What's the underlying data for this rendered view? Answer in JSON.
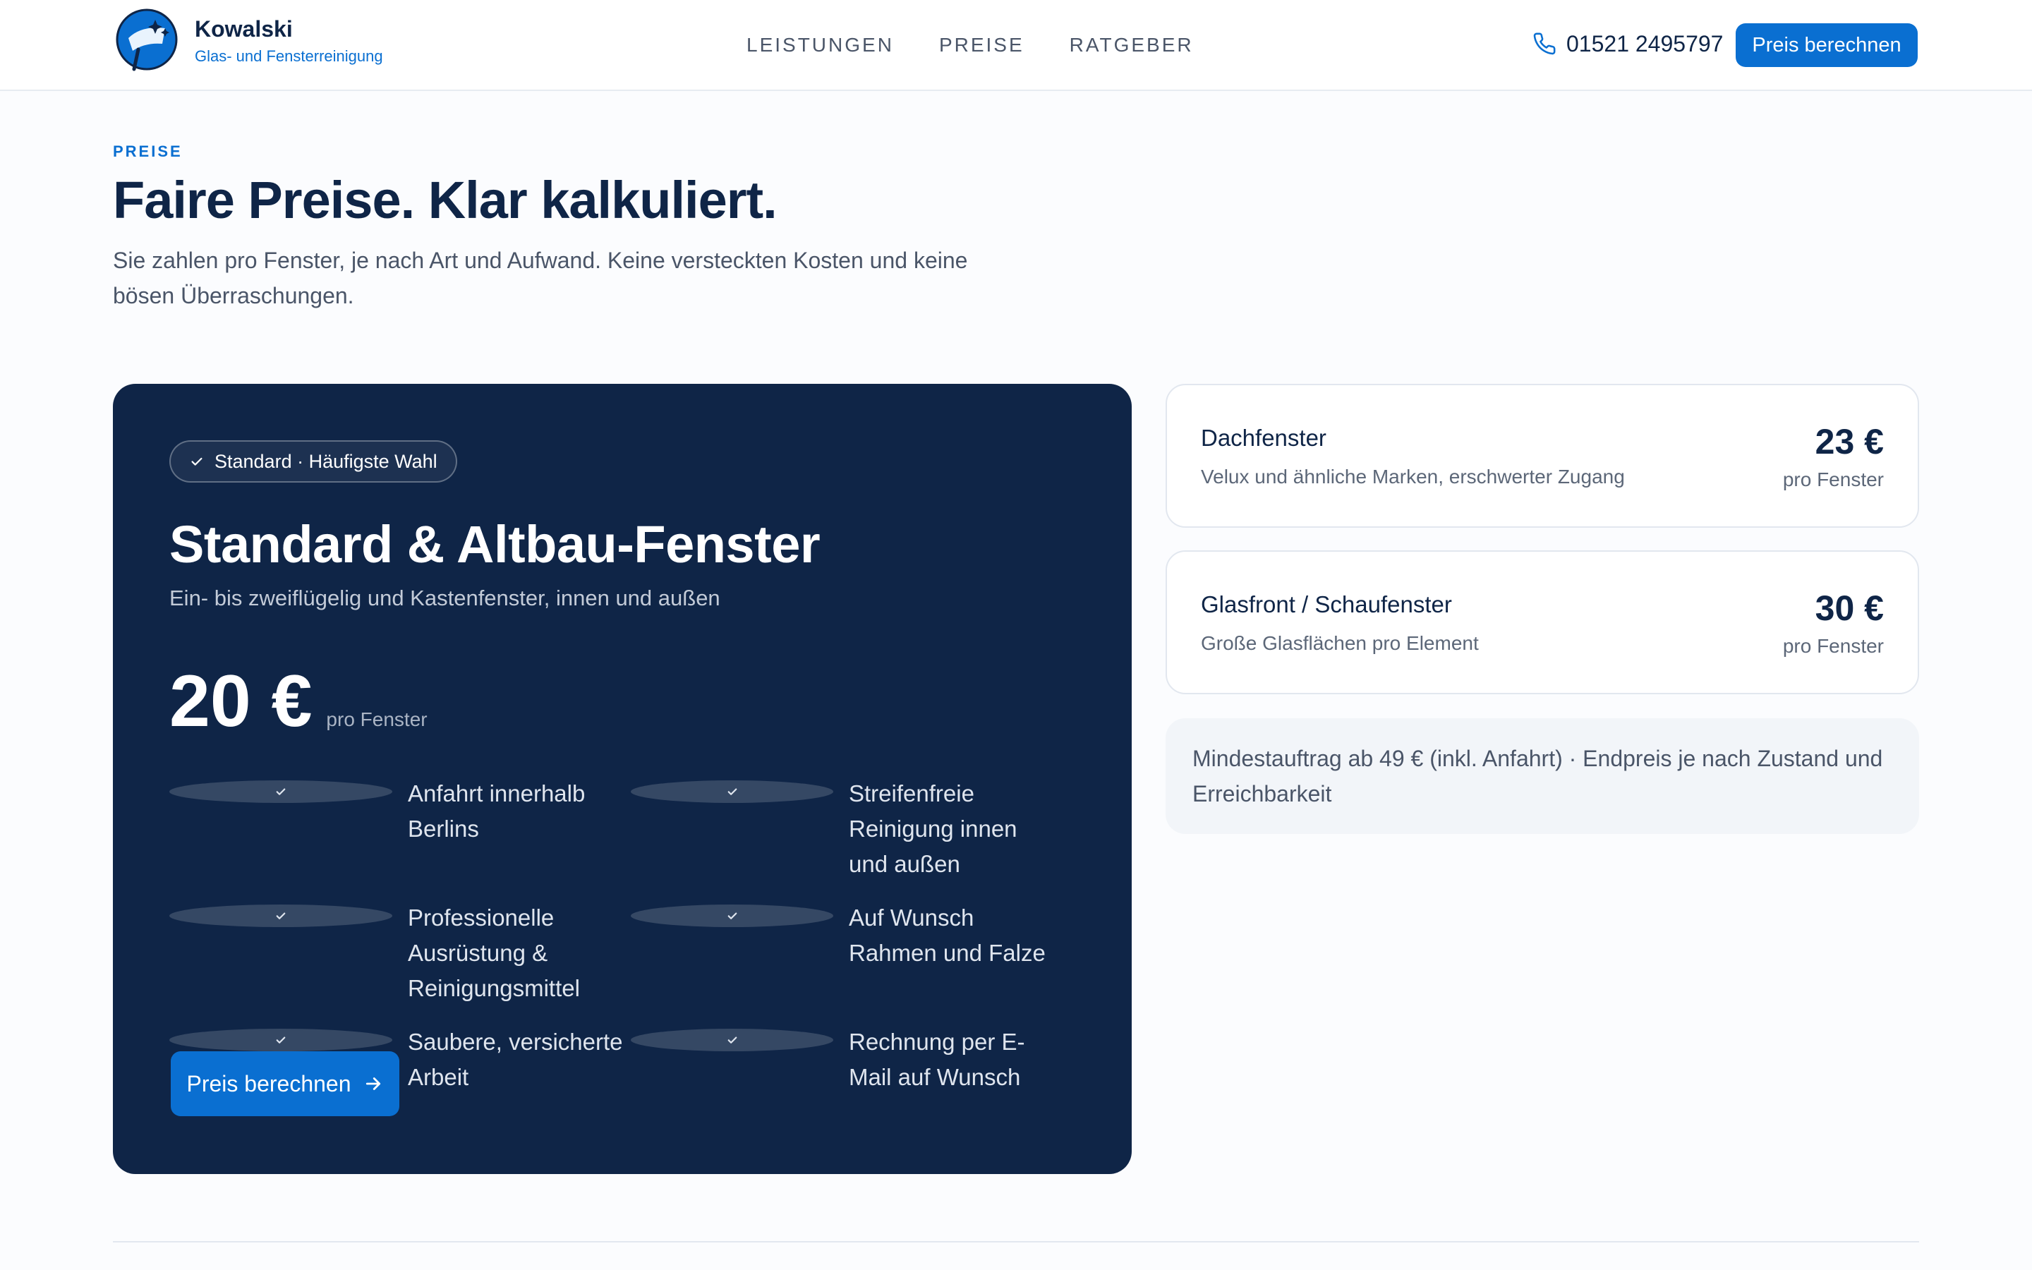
{
  "brand": {
    "name": "Kowalski",
    "tagline": "Glas- und Fensterreinigung"
  },
  "nav": {
    "items": [
      "LEISTUNGEN",
      "PREISE",
      "RATGEBER"
    ]
  },
  "header": {
    "phone": "01521 2495797",
    "cta_label": "Preis berechnen"
  },
  "intro": {
    "eyebrow": "PREISE",
    "title": "Faire Preise. Klar kalkuliert.",
    "lead": "Sie zahlen pro Fenster, je nach Art und Aufwand. Keine versteckten Kosten und keine bösen Überraschungen."
  },
  "featured": {
    "badge": "Standard · Häufigste Wahl",
    "title": "Standard & Altbau-Fenster",
    "subtitle": "Ein- bis zweiflügelig und Kastenfenster, innen und außen",
    "price": "20 €",
    "unit": "pro Fenster",
    "features": [
      "Anfahrt innerhalb Berlins",
      "Streifenfreie Reinigung innen und außen",
      "Professionelle Ausrüstung & Reinigungsmittel",
      "Auf Wunsch Rahmen und Falze",
      "Saubere, versicherte Arbeit",
      "Rechnung per E-Mail auf Wunsch"
    ],
    "cta_label": "Preis berechnen"
  },
  "side_cards": [
    {
      "name": "Dachfenster",
      "desc": "Velux und ähnliche Marken, erschwerter Zugang",
      "price": "23 €",
      "unit": "pro Fenster"
    },
    {
      "name": "Glasfront / Schaufenster",
      "desc": "Große Glasflächen pro Element",
      "price": "30 €",
      "unit": "pro Fenster"
    }
  ],
  "note": "Mindestauftrag ab 49 € (inkl. Anfahrt) · Endpreis je nach Zustand und Erreichbarkeit",
  "colors": {
    "primary": "#0a6fd1",
    "navy": "#0f2547",
    "background": "#fbfcfe"
  },
  "icons": {
    "logo": "window-cleaner-logo",
    "phone": "phone-icon",
    "check": "check-icon",
    "arrow": "arrow-right-icon"
  }
}
